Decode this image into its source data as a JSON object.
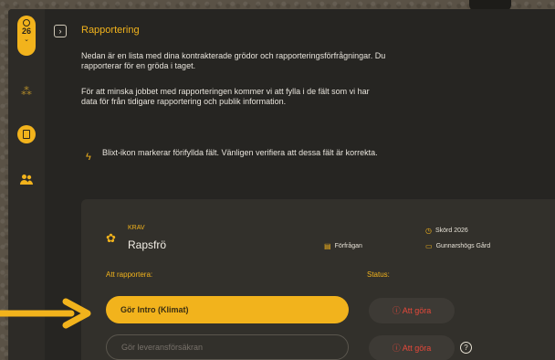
{
  "sidebar": {
    "badge_number": "26",
    "icons": [
      "clock-icon",
      "sparkle-icon",
      "document-icon",
      "people-icon"
    ]
  },
  "header": {
    "title": "Rapportering"
  },
  "intro": {
    "p1": "Nedan är en lista med dina kontrakterade grödor och rapporteringsförfrågningar. Du rapporterar för en gröda i taget.",
    "p2": "För att minska jobbet med rapporteringen kommer vi att fylla i de fält som vi har data för från tidigare rapportering och publik information.",
    "p3": "Blixt-ikon markerar förifyllda fält. Vänligen verifiera att dessa fält är korrekta."
  },
  "card": {
    "tag": "KRAV",
    "crop": "Rapsfrö",
    "harvest": "Skörd 2026",
    "request": "Förfrågan",
    "farm": "Gunnarshögs Gård",
    "to_report_label": "Att rapportera:",
    "status_label": "Status:",
    "tasks": [
      {
        "label": "Gör Intro (Klimat)",
        "status": "Att göra"
      },
      {
        "label": "Gör leveransförsäkran",
        "status": "Att göra"
      }
    ]
  },
  "colors": {
    "accent": "#f2b31c",
    "status_red": "#e5483a",
    "background": "#262522"
  }
}
